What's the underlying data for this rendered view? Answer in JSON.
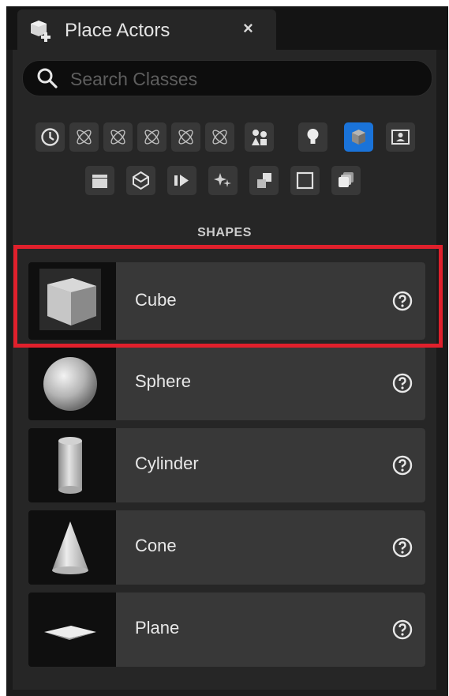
{
  "tab": {
    "title": "Place Actors",
    "close": "×"
  },
  "search": {
    "placeholder": "Search Classes",
    "value": ""
  },
  "categories": {
    "row1": [
      "recently-placed",
      "basic",
      "lights",
      "cinematic",
      "visual-effects",
      "geometry",
      "volumes",
      "all-classes",
      "shapes",
      "actor"
    ],
    "selected": "shapes"
  },
  "section": {
    "title": "SHAPES"
  },
  "items": [
    {
      "label": "Cube"
    },
    {
      "label": "Sphere"
    },
    {
      "label": "Cylinder"
    },
    {
      "label": "Cone"
    },
    {
      "label": "Plane"
    }
  ],
  "colors": {
    "panel": "#262626",
    "item_body": "#383838",
    "selected_category": "#1a73d9",
    "highlight": "#e0202c"
  }
}
